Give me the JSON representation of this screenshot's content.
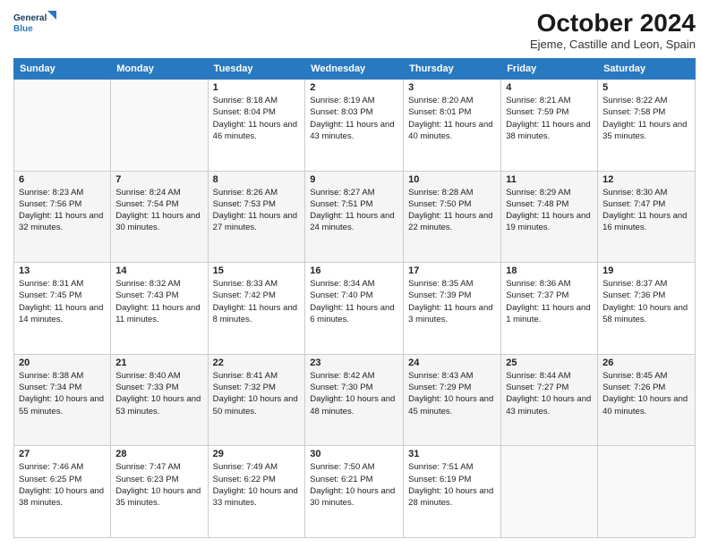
{
  "logo": {
    "line1": "General",
    "line2": "Blue"
  },
  "title": "October 2024",
  "subtitle": "Ejeme, Castille and Leon, Spain",
  "weekdays": [
    "Sunday",
    "Monday",
    "Tuesday",
    "Wednesday",
    "Thursday",
    "Friday",
    "Saturday"
  ],
  "weeks": [
    [
      {
        "day": "",
        "detail": ""
      },
      {
        "day": "",
        "detail": ""
      },
      {
        "day": "1",
        "detail": "Sunrise: 8:18 AM\nSunset: 8:04 PM\nDaylight: 11 hours and 46 minutes."
      },
      {
        "day": "2",
        "detail": "Sunrise: 8:19 AM\nSunset: 8:03 PM\nDaylight: 11 hours and 43 minutes."
      },
      {
        "day": "3",
        "detail": "Sunrise: 8:20 AM\nSunset: 8:01 PM\nDaylight: 11 hours and 40 minutes."
      },
      {
        "day": "4",
        "detail": "Sunrise: 8:21 AM\nSunset: 7:59 PM\nDaylight: 11 hours and 38 minutes."
      },
      {
        "day": "5",
        "detail": "Sunrise: 8:22 AM\nSunset: 7:58 PM\nDaylight: 11 hours and 35 minutes."
      }
    ],
    [
      {
        "day": "6",
        "detail": "Sunrise: 8:23 AM\nSunset: 7:56 PM\nDaylight: 11 hours and 32 minutes."
      },
      {
        "day": "7",
        "detail": "Sunrise: 8:24 AM\nSunset: 7:54 PM\nDaylight: 11 hours and 30 minutes."
      },
      {
        "day": "8",
        "detail": "Sunrise: 8:26 AM\nSunset: 7:53 PM\nDaylight: 11 hours and 27 minutes."
      },
      {
        "day": "9",
        "detail": "Sunrise: 8:27 AM\nSunset: 7:51 PM\nDaylight: 11 hours and 24 minutes."
      },
      {
        "day": "10",
        "detail": "Sunrise: 8:28 AM\nSunset: 7:50 PM\nDaylight: 11 hours and 22 minutes."
      },
      {
        "day": "11",
        "detail": "Sunrise: 8:29 AM\nSunset: 7:48 PM\nDaylight: 11 hours and 19 minutes."
      },
      {
        "day": "12",
        "detail": "Sunrise: 8:30 AM\nSunset: 7:47 PM\nDaylight: 11 hours and 16 minutes."
      }
    ],
    [
      {
        "day": "13",
        "detail": "Sunrise: 8:31 AM\nSunset: 7:45 PM\nDaylight: 11 hours and 14 minutes."
      },
      {
        "day": "14",
        "detail": "Sunrise: 8:32 AM\nSunset: 7:43 PM\nDaylight: 11 hours and 11 minutes."
      },
      {
        "day": "15",
        "detail": "Sunrise: 8:33 AM\nSunset: 7:42 PM\nDaylight: 11 hours and 8 minutes."
      },
      {
        "day": "16",
        "detail": "Sunrise: 8:34 AM\nSunset: 7:40 PM\nDaylight: 11 hours and 6 minutes."
      },
      {
        "day": "17",
        "detail": "Sunrise: 8:35 AM\nSunset: 7:39 PM\nDaylight: 11 hours and 3 minutes."
      },
      {
        "day": "18",
        "detail": "Sunrise: 8:36 AM\nSunset: 7:37 PM\nDaylight: 11 hours and 1 minute."
      },
      {
        "day": "19",
        "detail": "Sunrise: 8:37 AM\nSunset: 7:36 PM\nDaylight: 10 hours and 58 minutes."
      }
    ],
    [
      {
        "day": "20",
        "detail": "Sunrise: 8:38 AM\nSunset: 7:34 PM\nDaylight: 10 hours and 55 minutes."
      },
      {
        "day": "21",
        "detail": "Sunrise: 8:40 AM\nSunset: 7:33 PM\nDaylight: 10 hours and 53 minutes."
      },
      {
        "day": "22",
        "detail": "Sunrise: 8:41 AM\nSunset: 7:32 PM\nDaylight: 10 hours and 50 minutes."
      },
      {
        "day": "23",
        "detail": "Sunrise: 8:42 AM\nSunset: 7:30 PM\nDaylight: 10 hours and 48 minutes."
      },
      {
        "day": "24",
        "detail": "Sunrise: 8:43 AM\nSunset: 7:29 PM\nDaylight: 10 hours and 45 minutes."
      },
      {
        "day": "25",
        "detail": "Sunrise: 8:44 AM\nSunset: 7:27 PM\nDaylight: 10 hours and 43 minutes."
      },
      {
        "day": "26",
        "detail": "Sunrise: 8:45 AM\nSunset: 7:26 PM\nDaylight: 10 hours and 40 minutes."
      }
    ],
    [
      {
        "day": "27",
        "detail": "Sunrise: 7:46 AM\nSunset: 6:25 PM\nDaylight: 10 hours and 38 minutes."
      },
      {
        "day": "28",
        "detail": "Sunrise: 7:47 AM\nSunset: 6:23 PM\nDaylight: 10 hours and 35 minutes."
      },
      {
        "day": "29",
        "detail": "Sunrise: 7:49 AM\nSunset: 6:22 PM\nDaylight: 10 hours and 33 minutes."
      },
      {
        "day": "30",
        "detail": "Sunrise: 7:50 AM\nSunset: 6:21 PM\nDaylight: 10 hours and 30 minutes."
      },
      {
        "day": "31",
        "detail": "Sunrise: 7:51 AM\nSunset: 6:19 PM\nDaylight: 10 hours and 28 minutes."
      },
      {
        "day": "",
        "detail": ""
      },
      {
        "day": "",
        "detail": ""
      }
    ]
  ]
}
